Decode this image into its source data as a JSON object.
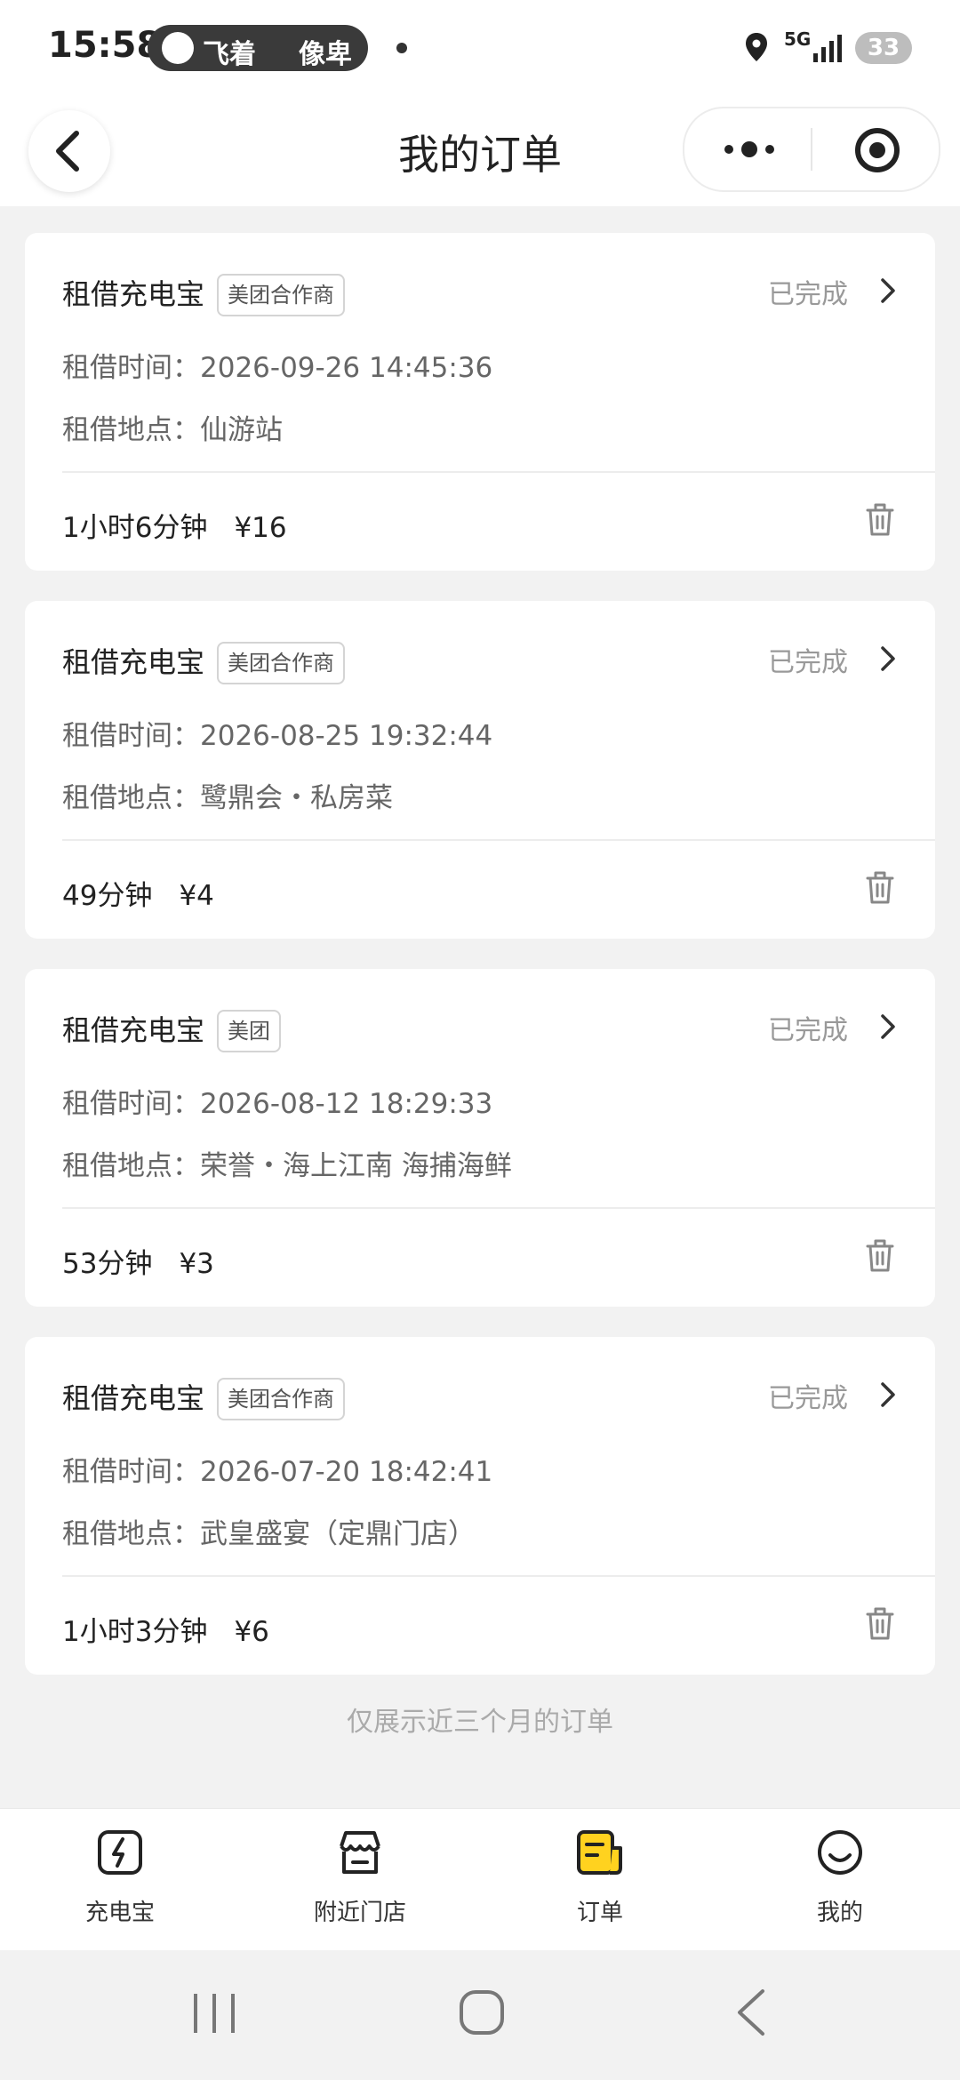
{
  "status_bar": {
    "time": "15:58",
    "pill_text_1": "飞着",
    "pill_text_2": "像卑",
    "network": "5G",
    "battery": "33"
  },
  "header": {
    "title": "我的订单",
    "back_icon": "chevron-left-icon",
    "more_icon": "more-dots-icon",
    "close_icon": "target-close-icon"
  },
  "orders": [
    {
      "title": "租借充电宝",
      "tag": "美团合作商",
      "status": "已完成",
      "time_label": "租借时间：",
      "time": "2026-09-26 14:45:36",
      "place_label": "租借地点：",
      "place": "仙游站",
      "duration": "1小时6分钟",
      "price": "¥16"
    },
    {
      "title": "租借充电宝",
      "tag": "美团合作商",
      "status": "已完成",
      "time_label": "租借时间：",
      "time": "2026-08-25 19:32:44",
      "place_label": "租借地点：",
      "place": "鹭鼎会・私房菜",
      "duration": "49分钟",
      "price": "¥4"
    },
    {
      "title": "租借充电宝",
      "tag": "美团",
      "status": "已完成",
      "time_label": "租借时间：",
      "time": "2026-08-12 18:29:33",
      "place_label": "租借地点：",
      "place": "荣誉・海上江南 海捕海鲜",
      "duration": "53分钟",
      "price": "¥3"
    },
    {
      "title": "租借充电宝",
      "tag": "美团合作商",
      "status": "已完成",
      "time_label": "租借时间：",
      "time": "2026-07-20 18:42:41",
      "place_label": "租借地点：",
      "place": "武皇盛宴（定鼎门店）",
      "duration": "1小时3分钟",
      "price": "¥6"
    }
  ],
  "footer_note": "仅展示近三个月的订单",
  "tabs": [
    {
      "label": "充电宝",
      "icon": "power-bank-icon",
      "active": false
    },
    {
      "label": "附近门店",
      "icon": "store-icon",
      "active": false
    },
    {
      "label": "订单",
      "icon": "order-icon",
      "active": true
    },
    {
      "label": "我的",
      "icon": "smiley-icon",
      "active": false
    }
  ],
  "colors": {
    "accent": "#FFD21F",
    "background": "#F2F2F2",
    "status_text": "#999999"
  }
}
